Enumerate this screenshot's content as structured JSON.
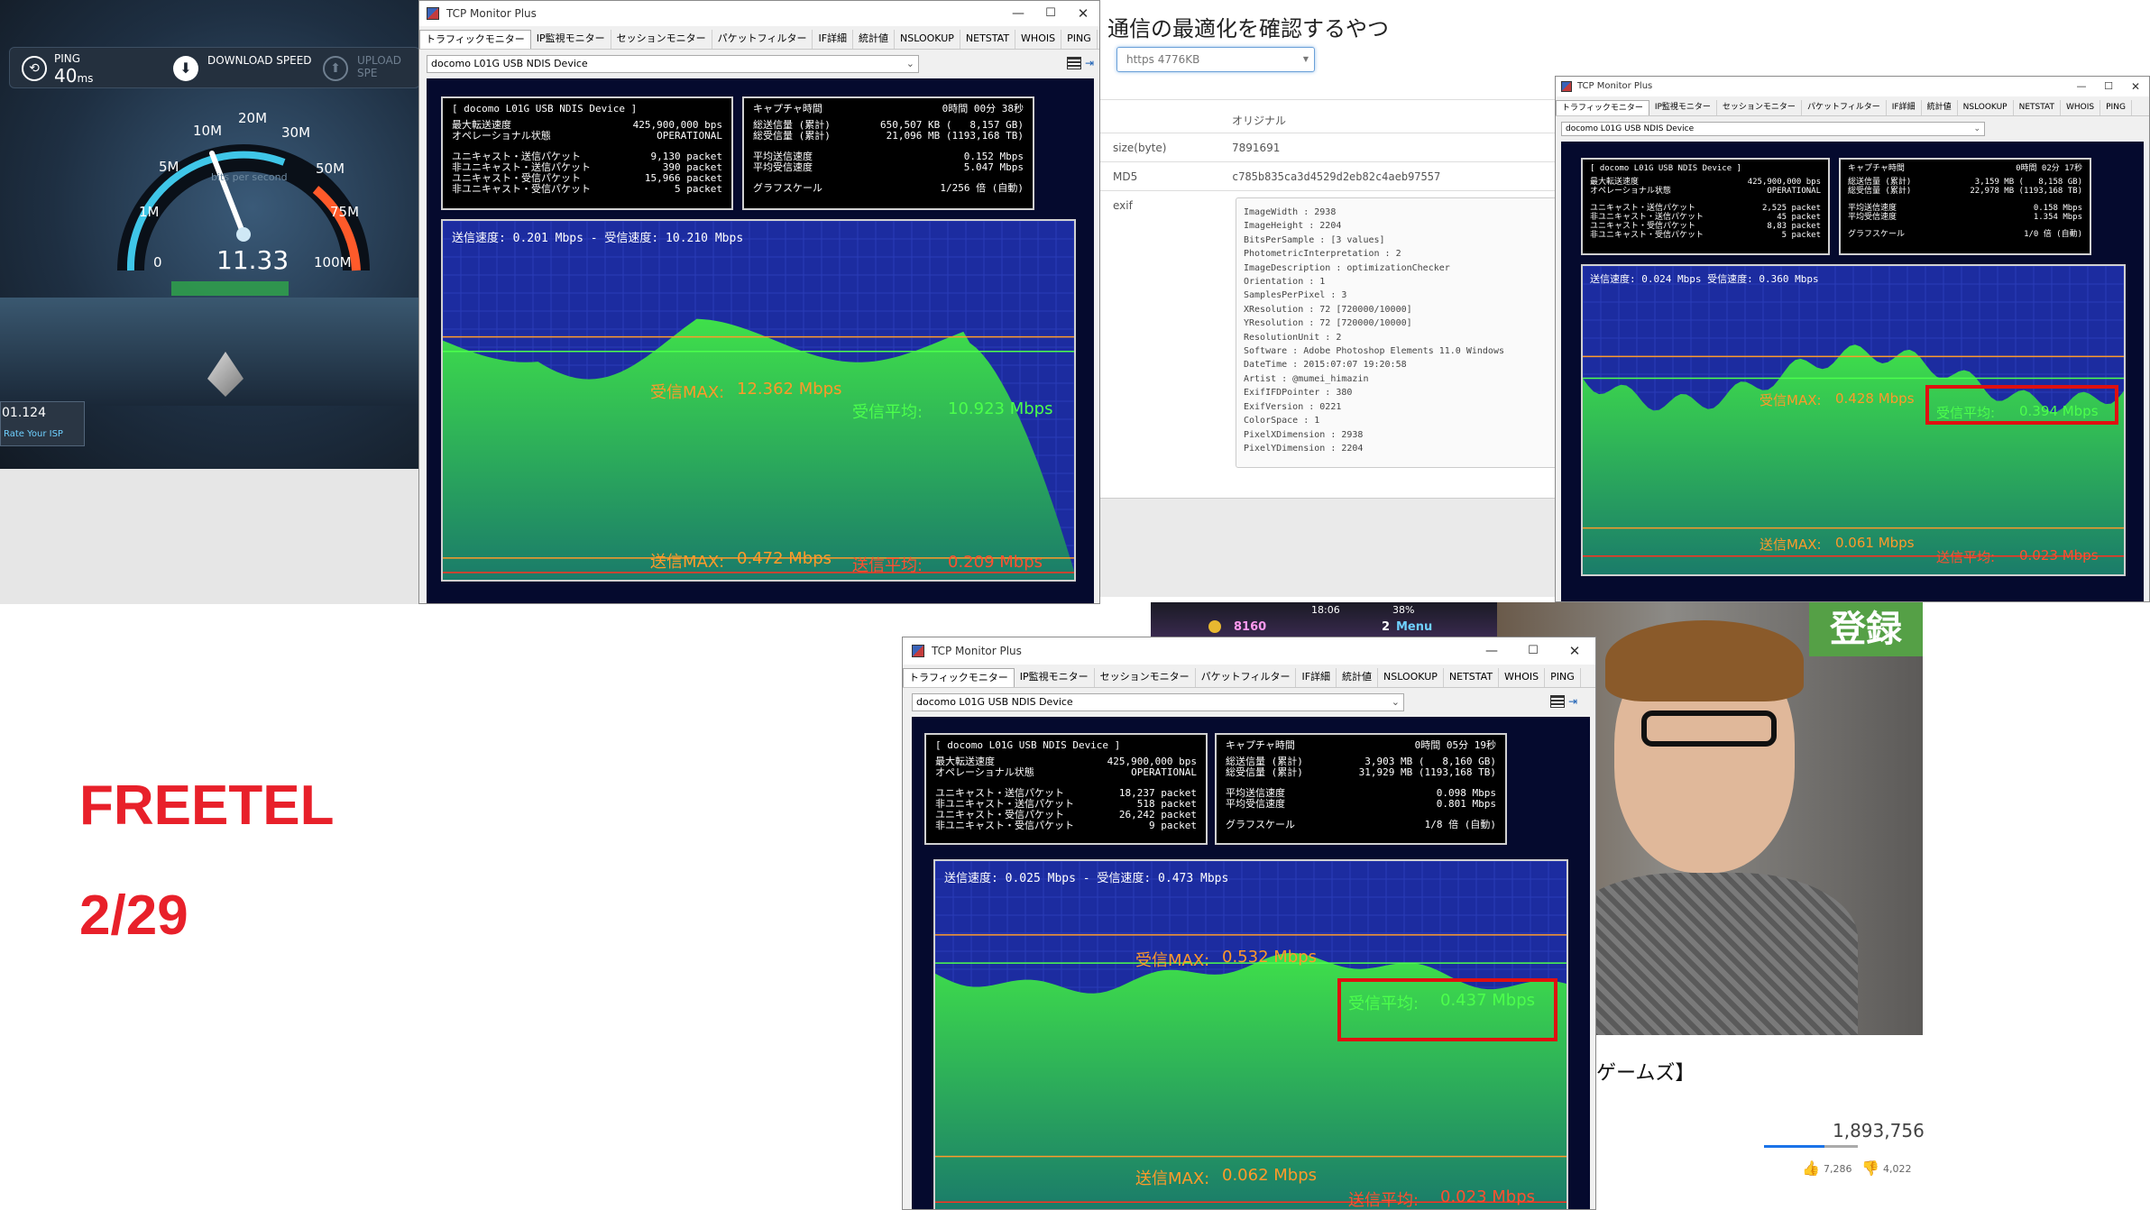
{
  "speedtest": {
    "ping_label": "PING",
    "ping_value": "40",
    "ping_unit": "ms",
    "download_label": "DOWNLOAD SPEED",
    "upload_label": "UPLOAD SPE",
    "gauge_ticks": [
      "0",
      "1M",
      "5M",
      "10M",
      "20M",
      "30M",
      "50M",
      "75M",
      "100M"
    ],
    "gauge_unit": "bits per second",
    "result": "11.33",
    "ip_partial": "01.124",
    "rate_isp": "Rate Your ISP"
  },
  "article": {
    "heading": "通信の最適化を確認するやつ",
    "dropdown_value": "https 4776KB",
    "col_original": "オリジナル",
    "rows": [
      {
        "key": "size(byte)",
        "value": "7891691"
      },
      {
        "key": "MD5",
        "value": "c785b835ca3d4529d2eb82c4aeb97557"
      },
      {
        "key": "exif",
        "value": ""
      }
    ],
    "exif_lines": [
      "ImageWidth : 2938",
      "ImageHeight : 2204",
      "BitsPerSample : [3 values]",
      "PhotometricInterpretation : 2",
      "ImageDescription : optimizationChecker",
      "Orientation : 1",
      "SamplesPerPixel : 3",
      "XResolution : 72 [720000/10000]",
      "YResolution : 72 [720000/10000]",
      "ResolutionUnit : 2",
      "Software : Adobe Photoshop Elements 11.0 Windows",
      "DateTime : 2015:07:07 19:20:58",
      "Artist : @mumei_himazin",
      "ExifIFDPointer : 380",
      "ExifVersion : 0221",
      "ColorSpace : 1",
      "PixelXDimension : 2938",
      "PixelYDimension : 2204"
    ]
  },
  "freetel": {
    "title": "FREETEL",
    "date": "2/29"
  },
  "tabs": [
    "トラフィックモニター",
    "IP監視モニター",
    "セッションモニター",
    "パケットフィルター",
    "IF詳細",
    "統計値",
    "NSLOOKUP",
    "NETSTAT",
    "WHOIS",
    "PING"
  ],
  "windows": {
    "w1": {
      "title": "TCP Monitor Plus",
      "device": "docomo L01G USB NDIS Device",
      "info_left": {
        "header": "[ docomo L01G USB NDIS Device ]",
        "rows": [
          {
            "k": "最大転送速度",
            "v": "425,900,000 bps"
          },
          {
            "k": "オペレーショナル状態",
            "v": "OPERATIONAL"
          },
          {
            "k": "",
            "v": ""
          },
          {
            "k": "ユニキャスト・送信パケット",
            "v": "9,130 packet"
          },
          {
            "k": "非ユニキャスト・送信パケット",
            "v": "390 packet"
          },
          {
            "k": "ユニキャスト・受信パケット",
            "v": "15,966 packet"
          },
          {
            "k": "非ユニキャスト・受信パケット",
            "v": "5 packet"
          }
        ]
      },
      "info_right": {
        "capture_k": "キャプチャ時間",
        "capture_v": "0時間 00分 38秒",
        "rows": [
          {
            "k": "総送信量 (累計)",
            "v": "650,507 KB (   8,157 GB)"
          },
          {
            "k": "総受信量 (累計)",
            "v": "21,096 MB (1193,168 TB)"
          },
          {
            "k": "",
            "v": ""
          },
          {
            "k": "平均送信速度",
            "v": "0.152 Mbps"
          },
          {
            "k": "平均受信速度",
            "v": "5.047 Mbps"
          },
          {
            "k": "",
            "v": ""
          },
          {
            "k": "グラフスケール",
            "v": "1/256 倍 (自動)"
          }
        ]
      },
      "speed_line": "送信速度:  0.201 Mbps  -  受信速度:  10.210 Mbps",
      "recv_max_label": "受信MAX:",
      "recv_max_value": "12.362 Mbps",
      "recv_avg_label": "受信平均:",
      "recv_avg_value": "10.923 Mbps",
      "send_max_label": "送信MAX:",
      "send_max_value": "0.472 Mbps",
      "send_avg_label": "送信平均:",
      "send_avg_value": "0.209 Mbps"
    },
    "w2": {
      "title": "TCP Monitor Plus",
      "device": "docomo L01G USB NDIS Device",
      "info_left": {
        "header": "[ docomo L01G USB NDIS Device ]",
        "rows": [
          {
            "k": "最大転送速度",
            "v": "425,900,000 bps"
          },
          {
            "k": "オペレーショナル状態",
            "v": "OPERATIONAL"
          },
          {
            "k": "",
            "v": ""
          },
          {
            "k": "ユニキャスト・送信パケット",
            "v": "2,525 packet"
          },
          {
            "k": "非ユニキャスト・送信パケット",
            "v": "45 packet"
          },
          {
            "k": "ユニキャスト・受信パケット",
            "v": "8,83 packet"
          },
          {
            "k": "非ユニキャスト・受信パケット",
            "v": "5 packet"
          }
        ]
      },
      "info_right": {
        "capture_k": "キャプチャ時間",
        "capture_v": "0時間 02分 17秒",
        "rows": [
          {
            "k": "総送信量 (累計)",
            "v": "3,159 MB (   8,158 GB)"
          },
          {
            "k": "総受信量 (累計)",
            "v": "22,978 MB (1193,168 TB)"
          },
          {
            "k": "",
            "v": ""
          },
          {
            "k": "平均送信速度",
            "v": "0.158 Mbps"
          },
          {
            "k": "平均受信速度",
            "v": "1.354 Mbps"
          },
          {
            "k": "",
            "v": ""
          },
          {
            "k": "グラフスケール",
            "v": "1/0 倍 (自動)"
          }
        ]
      },
      "speed_line": "送信速度:  0.024 Mbps    受信速度:  0.360 Mbps",
      "recv_max_label": "受信MAX:",
      "recv_max_value": "0.428 Mbps",
      "recv_avg_label": "受信平均:",
      "recv_avg_value": "0.394 Mbps",
      "send_max_label": "送信MAX:",
      "send_max_value": "0.061 Mbps",
      "send_avg_label": "送信平均:",
      "send_avg_value": "0.023 Mbps"
    },
    "w3": {
      "title": "TCP Monitor Plus",
      "device": "docomo L01G USB NDIS Device",
      "info_left": {
        "header": "[ docomo L01G USB NDIS Device ]",
        "rows": [
          {
            "k": "最大転送速度",
            "v": "425,900,000 bps"
          },
          {
            "k": "オペレーショナル状態",
            "v": "OPERATIONAL"
          },
          {
            "k": "",
            "v": ""
          },
          {
            "k": "ユニキャスト・送信パケット",
            "v": "18,237 packet"
          },
          {
            "k": "非ユニキャスト・送信パケット",
            "v": "518 packet"
          },
          {
            "k": "ユニキャスト・受信パケット",
            "v": "26,242 packet"
          },
          {
            "k": "非ユニキャスト・受信パケット",
            "v": "9 packet"
          }
        ]
      },
      "info_right": {
        "capture_k": "キャプチャ時間",
        "capture_v": "0時間 05分 19秒",
        "rows": [
          {
            "k": "総送信量 (累計)",
            "v": "3,903 MB (   8,160 GB)"
          },
          {
            "k": "総受信量 (累計)",
            "v": "31,929 MB (1193,168 TB)"
          },
          {
            "k": "",
            "v": ""
          },
          {
            "k": "平均送信速度",
            "v": "0.098 Mbps"
          },
          {
            "k": "平均受信速度",
            "v": "0.801 Mbps"
          },
          {
            "k": "",
            "v": ""
          },
          {
            "k": "グラフスケール",
            "v": "1/8 倍 (自動)"
          }
        ]
      },
      "speed_line": "送信速度:  0.025 Mbps  -  受信速度:  0.473 Mbps",
      "recv_max_label": "受信MAX:",
      "recv_max_value": "0.532 Mbps",
      "recv_avg_label": "受信平均:",
      "recv_avg_value": "0.437 Mbps",
      "send_max_label": "送信MAX:",
      "send_max_value": "0.062 Mbps",
      "send_avg_label": "送信平均:",
      "send_avg_value": "0.023 Mbps"
    }
  },
  "phone_status": {
    "time": "18:06",
    "battery": "38%",
    "coins": "8160",
    "level": "2",
    "menu": "Menu"
  },
  "video": {
    "register_badge": "登録",
    "title_partial": "ゲームズ】",
    "views": "1,893,756",
    "likes": "7,286",
    "dislikes": "4,022"
  },
  "colors": {
    "graph_bg": "#1c2ca0",
    "graph_fill": "#2fc83a",
    "recv_label": "#ff9a2a",
    "avg_label": "#4cff4c",
    "send_label": "#ff5030",
    "highlight": "#e01010",
    "freetel_red": "#e8202a"
  }
}
